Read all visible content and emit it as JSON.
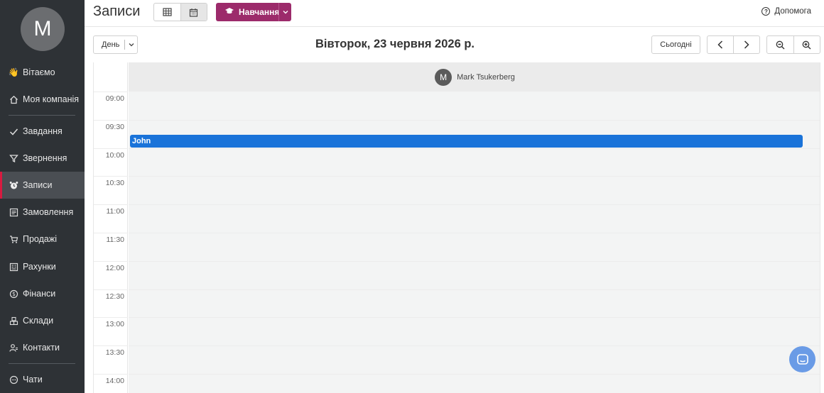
{
  "sidebar": {
    "avatar_letter": "M",
    "items": [
      {
        "label": "Вітаємо",
        "icon": "wave-hand-icon"
      },
      {
        "label": "Моя компанія",
        "icon": "home-icon"
      },
      {
        "label": "Завдання",
        "icon": "check-icon"
      },
      {
        "label": "Звернення",
        "icon": "funnel-icon"
      },
      {
        "label": "Записи",
        "icon": "alarm-clock-icon",
        "active": true
      },
      {
        "label": "Замовлення",
        "icon": "order-list-icon"
      },
      {
        "label": "Продажі",
        "icon": "cart-icon"
      },
      {
        "label": "Рахунки",
        "icon": "invoice-icon"
      },
      {
        "label": "Фінанси",
        "icon": "dollar-circle-icon"
      },
      {
        "label": "Склади",
        "icon": "boxes-icon"
      },
      {
        "label": "Контакти",
        "icon": "contacts-icon"
      },
      {
        "label": "Чати",
        "icon": "chat-icon"
      }
    ]
  },
  "header": {
    "title": "Записи",
    "training_label": "Навчання",
    "help_label": "Допомога"
  },
  "toolbar": {
    "view_select": "День",
    "date": "Вівторок, 23 червня 2026 р.",
    "today_label": "Сьогодні"
  },
  "calendar": {
    "resource": {
      "initial": "M",
      "name": "Mark Tsukerberg"
    },
    "times": [
      "09:00",
      "09:30",
      "10:00",
      "10:30",
      "11:00",
      "11:30",
      "12:00",
      "12:30",
      "13:00",
      "13:30",
      "14:00"
    ],
    "events": [
      {
        "title": "John",
        "start": "09:30",
        "end": "10:00"
      }
    ]
  },
  "colors": {
    "sidebar_bg": "#2e3236",
    "active_marker": "#d81b40",
    "training_btn": "#9c2b6b",
    "event": "#1a73d9",
    "chat_fab": "#6a9be6"
  }
}
